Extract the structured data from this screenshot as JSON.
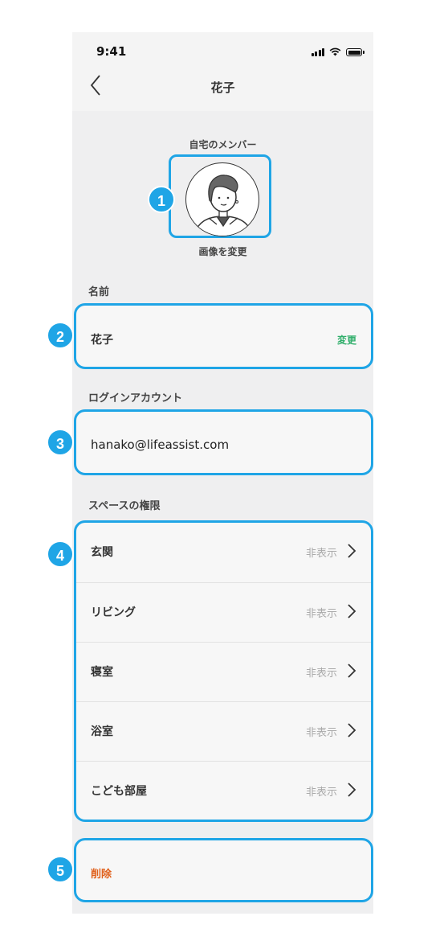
{
  "status_bar": {
    "time": "9:41"
  },
  "nav": {
    "title": "花子",
    "back_icon": "chevron-left-icon"
  },
  "avatar": {
    "caption": "自宅のメンバー",
    "change_label": "画像を変更"
  },
  "name_section": {
    "label": "名前",
    "value": "花子",
    "action": "変更"
  },
  "account_section": {
    "label": "ログインアカウント",
    "email": "hanako@lifeassist.com"
  },
  "spaces_section": {
    "label": "スペースの権限",
    "items": [
      {
        "label": "玄関",
        "value": "非表示"
      },
      {
        "label": "リビング",
        "value": "非表示"
      },
      {
        "label": "寝室",
        "value": "非表示"
      },
      {
        "label": "浴室",
        "value": "非表示"
      },
      {
        "label": "こども部屋",
        "value": "非表示"
      }
    ]
  },
  "delete": {
    "label": "削除"
  },
  "badges": [
    "1",
    "2",
    "3",
    "4",
    "5"
  ],
  "colors": {
    "accent": "#1fa5e6",
    "change": "#2fae6a",
    "delete": "#e0601b",
    "background": "#efeff0"
  }
}
